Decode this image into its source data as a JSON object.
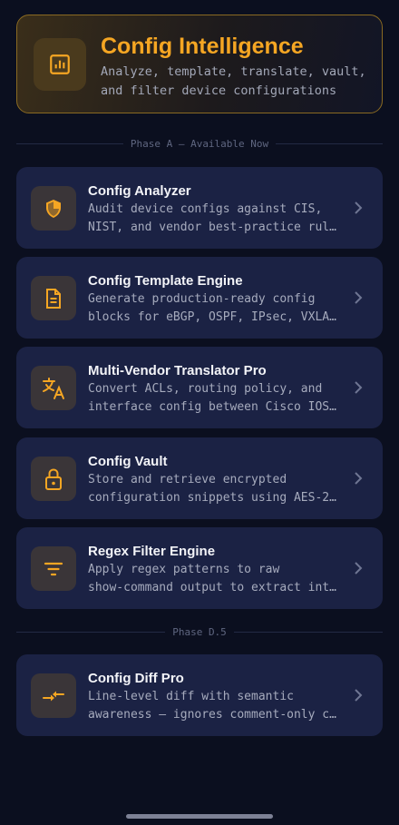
{
  "header": {
    "title": "Config Intelligence",
    "subtitle_line1": "Analyze, template, translate, vault,",
    "subtitle_line2": "and filter device configurations",
    "icon": "bar-chart-icon"
  },
  "sections": [
    {
      "label": "Phase A — Available Now"
    },
    {
      "label": "Phase D.5"
    }
  ],
  "cards": [
    {
      "title": "Config Analyzer",
      "line1": "Audit device configs against CIS,",
      "line2": "NIST, and vendor best-practice rul…",
      "icon": "shield-icon"
    },
    {
      "title": "Config Template Engine",
      "line1": "Generate production-ready config",
      "line2": "blocks for eBGP, OSPF, IPsec, VXLA…",
      "icon": "document-icon"
    },
    {
      "title": "Multi-Vendor Translator Pro",
      "line1": "Convert ACLs, routing policy, and",
      "line2": "interface config between Cisco IOS…",
      "icon": "translate-icon"
    },
    {
      "title": "Config Vault",
      "line1": "Store and retrieve encrypted",
      "line2": "configuration snippets using AES-2…",
      "icon": "lock-icon"
    },
    {
      "title": "Regex Filter Engine",
      "line1": "Apply regex patterns to raw",
      "line2": "show-command output to extract int…",
      "icon": "filter-icon"
    },
    {
      "title": "Config Diff Pro",
      "line1": "Line-level diff with semantic",
      "line2": "awareness — ignores comment-only c…",
      "icon": "compare-arrows-icon"
    }
  ],
  "colors": {
    "accent": "#f5a623",
    "background": "#0b0f1f",
    "card": "#1b2244"
  }
}
